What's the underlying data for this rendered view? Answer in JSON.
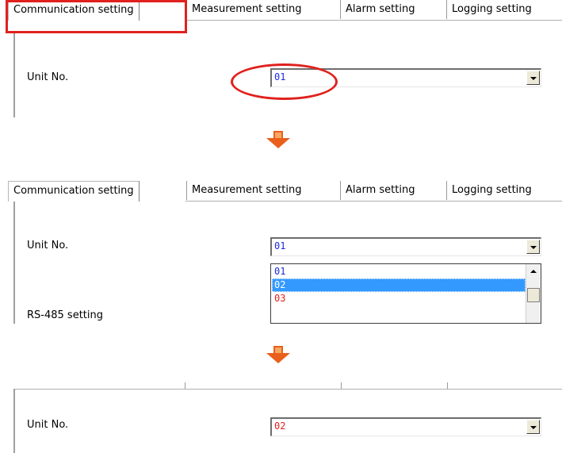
{
  "tabs": [
    "Communication setting",
    "Measurement setting",
    "Alarm setting",
    "Logging setting"
  ],
  "unit_label": "Unit No.",
  "rs485_label": "RS-485 setting",
  "step1_value": "01",
  "step2_value": "01",
  "dropdown_options": [
    "01",
    "02",
    "03"
  ],
  "dropdown_selected_index": 1,
  "step3_value": "02",
  "colors": {
    "highlight_red": "#e0211d",
    "value_blue": "#1a2bd6",
    "value_red": "#e0211d",
    "selection_blue": "#3399ff",
    "arrow_orange": "#e8601c"
  },
  "icons": [
    "down-arrow-icon",
    "combo-dropdown-icon",
    "scroll-up-icon"
  ]
}
